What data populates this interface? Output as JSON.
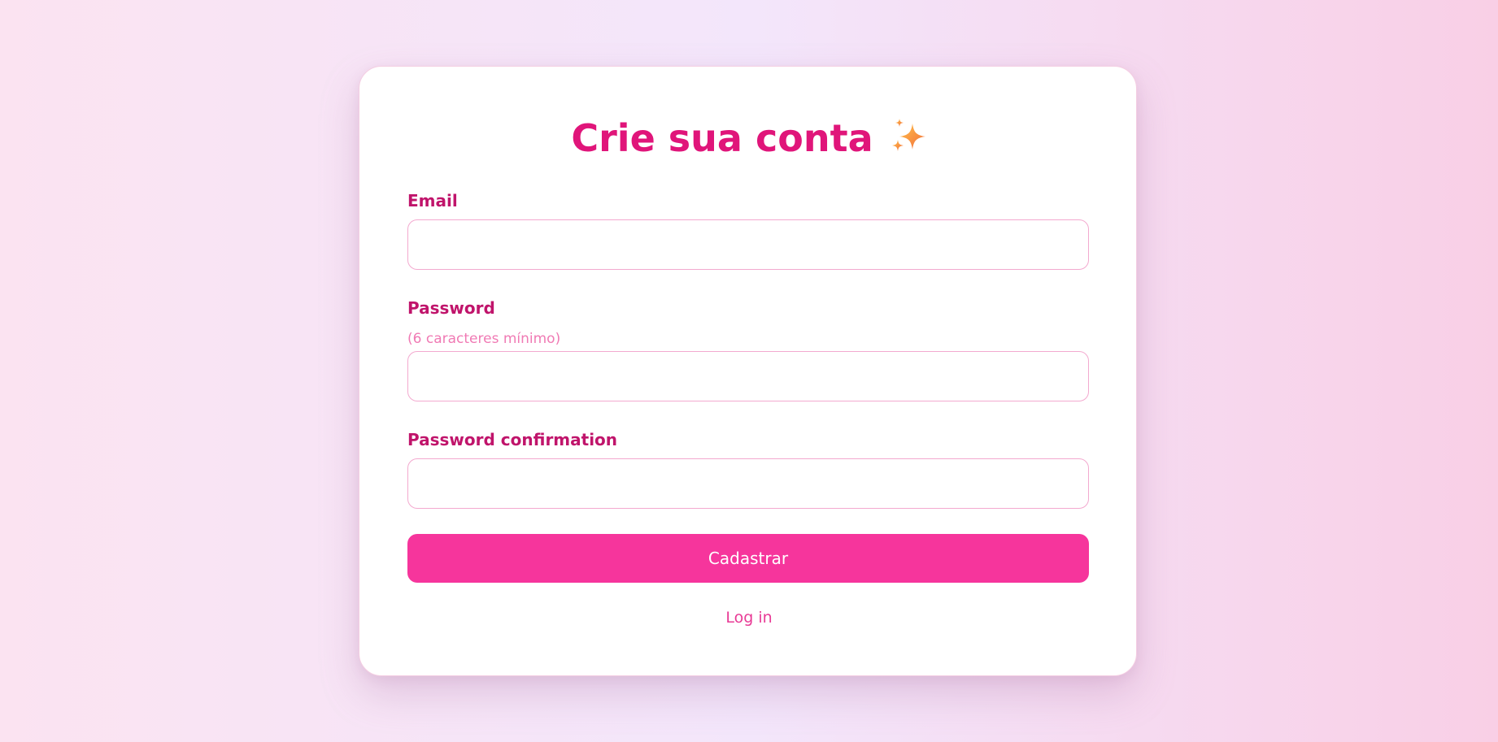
{
  "form": {
    "title": "Crie sua conta",
    "title_icon": "sparkles-icon",
    "email": {
      "label": "Email",
      "value": "",
      "placeholder": ""
    },
    "password": {
      "label": "Password",
      "hint": "(6 caracteres mínimo)",
      "value": "",
      "placeholder": ""
    },
    "password_confirmation": {
      "label": "Password confirmation",
      "value": "",
      "placeholder": ""
    },
    "submit_label": "Cadastrar",
    "login_link_label": "Log in"
  },
  "colors": {
    "accent": "#f6359c",
    "title": "#e0157a",
    "label": "#c0146b",
    "hint": "#f07ab4",
    "input_border": "#f3a9cf",
    "link": "#e83a95"
  }
}
